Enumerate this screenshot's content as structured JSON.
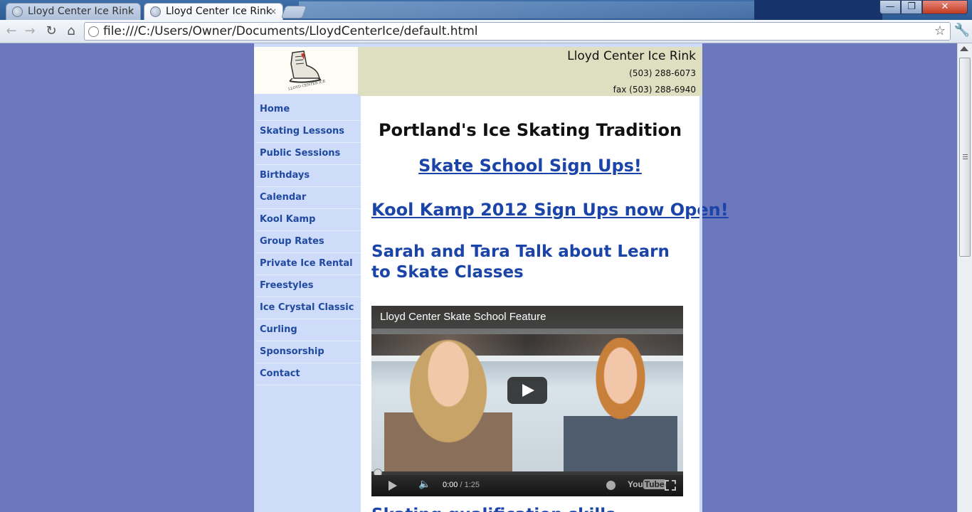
{
  "browser": {
    "tabs": [
      {
        "label": "Lloyd Center Ice Rink",
        "close": "×",
        "active": false
      },
      {
        "label": "Lloyd Center Ice Rink",
        "close": "×",
        "active": true
      }
    ],
    "window_controls": {
      "minimize": "—",
      "maximize": "❐",
      "close": "✕"
    },
    "nav": {
      "back": "←",
      "forward": "→",
      "reload": "↻",
      "home": "⌂"
    },
    "address_bar": {
      "url": "file:///C:/Users/Owner/Documents/LloydCenterIce/default.html"
    },
    "icons": {
      "bookmark": "☆",
      "wrench": "🔧"
    }
  },
  "header": {
    "logo_text": "LLOYD CENTER ICE RINK",
    "rink_name": "Lloyd Center Ice Rink",
    "phone": "(503) 288-6073",
    "fax": "fax (503) 288-6940"
  },
  "sidebar": {
    "items": [
      {
        "label": "Home"
      },
      {
        "label": "Skating Lessons"
      },
      {
        "label": "Public Sessions"
      },
      {
        "label": "Birthdays"
      },
      {
        "label": "Calendar"
      },
      {
        "label": "Kool Kamp"
      },
      {
        "label": "Group Rates"
      },
      {
        "label": "Private Ice Rental"
      },
      {
        "label": "Freestyles"
      },
      {
        "label": "Ice Crystal Classic"
      },
      {
        "label": "Curling"
      },
      {
        "label": "Sponsorship"
      },
      {
        "label": "Contact"
      }
    ]
  },
  "main": {
    "headline": "Portland's Ice Skating Tradition",
    "skate_school_link": " Skate School Sign Ups!",
    "kool_kamp_link": "Kool Kamp 2012 Sign Ups now Open!",
    "video_heading": "Sarah and Tara Talk about Learn to Skate Classes",
    "video": {
      "title": "Lloyd Center Skate School Feature",
      "current_time": "0:00",
      "separator": " / ",
      "duration": "1:25",
      "brand": "You",
      "brand_tube": "Tube",
      "progress": 0
    },
    "partial_heading": "Skating qualification skills"
  },
  "colors": {
    "page_background": "#6b78bd",
    "sidebar": "#cfdcf9",
    "header_band": "#dedfc0",
    "link": "#1b44a8"
  }
}
